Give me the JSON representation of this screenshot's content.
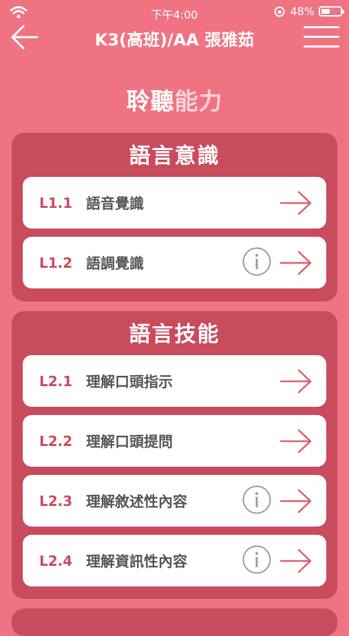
{
  "status": {
    "time": "下午4:00",
    "battery": "48%",
    "battery_level": 0.48
  },
  "nav": {
    "title": "K3(高班)/AA 張雅茹"
  },
  "page": {
    "title_bold": "聆聽",
    "title_light": "能力"
  },
  "sections": [
    {
      "title": "語言意識",
      "items": [
        {
          "code": "L1.1",
          "label": "語音覺識",
          "info": false
        },
        {
          "code": "L1.2",
          "label": "語調覺識",
          "info": true
        }
      ]
    },
    {
      "title": "語言技能",
      "items": [
        {
          "code": "L2.1",
          "label": "理解口頭指示",
          "info": false
        },
        {
          "code": "L2.2",
          "label": "理解口頭提問",
          "info": false
        },
        {
          "code": "L2.3",
          "label": "理解敘述性內容",
          "info": true
        },
        {
          "code": "L2.4",
          "label": "理解資訊性內容",
          "info": true
        }
      ]
    }
  ],
  "colors": {
    "background": "#ef7382",
    "section": "#c94b5e",
    "accent": "#e05a6e"
  },
  "icons": {
    "back": "arrow-left-icon",
    "menu": "hamburger-menu-icon",
    "info": "info-icon",
    "go": "arrow-right-icon"
  }
}
